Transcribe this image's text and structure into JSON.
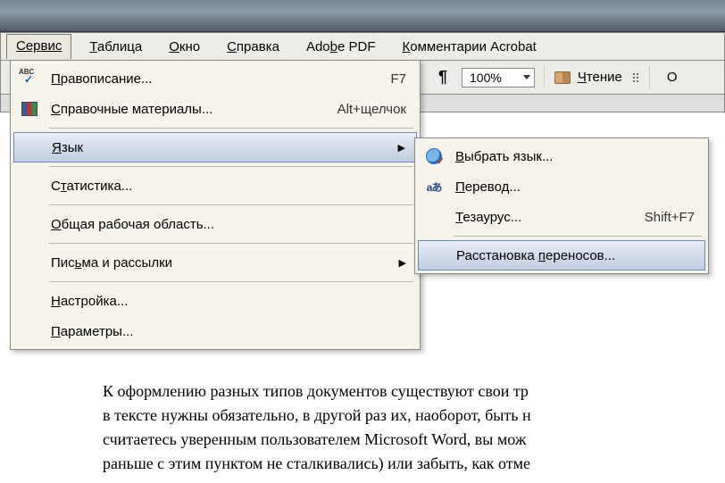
{
  "menubar": {
    "items": [
      {
        "label": "Сервис",
        "underline_index": 0
      },
      {
        "label": "Таблица",
        "underline_index": 0
      },
      {
        "label": "Окно",
        "underline_index": 0
      },
      {
        "label": "Справка",
        "underline_index": 0
      },
      {
        "label": "Adobe PDF",
        "underline_index": 2
      },
      {
        "label": "Комментарии Acrobat",
        "underline_index": 0
      }
    ]
  },
  "toolbar": {
    "pilcrow": "¶",
    "zoom": "100%",
    "read_label": "Чтение",
    "truncated": "О"
  },
  "main_menu": {
    "items": [
      {
        "label": "Правописание...",
        "shortcut": "F7",
        "icon": "abc",
        "underline_text": "П"
      },
      {
        "label": "Справочные материалы...",
        "shortcut": "Alt+щелчок",
        "icon": "books",
        "underline_text": "С"
      },
      {
        "label": "Язык",
        "has_submenu": true,
        "highlighted": true,
        "underline_text": "Я"
      },
      {
        "label": "Статистика...",
        "underline_text": "т"
      },
      {
        "label": "Общая рабочая область...",
        "underline_text": "О"
      },
      {
        "label": "Письма и рассылки",
        "has_submenu": true,
        "underline_text": "ь"
      },
      {
        "label": "Настройка...",
        "underline_text": "Н"
      },
      {
        "label": "Параметры...",
        "underline_text": "П"
      }
    ]
  },
  "sub_menu": {
    "items": [
      {
        "label": "Выбрать язык...",
        "icon": "globe",
        "underline_text": "В"
      },
      {
        "label": "Перевод...",
        "icon": "trans",
        "underline_text": "П"
      },
      {
        "label": "Тезаурус...",
        "shortcut": "Shift+F7",
        "underline_text": "Т"
      },
      {
        "label": "Расстановка переносов...",
        "highlighted": true,
        "underline_text": "п"
      }
    ]
  },
  "document": {
    "line1": "К оформлению разных типов документов существуют свои тр",
    "line2": "в тексте нужны обязательно, в другой раз их, наоборот, быть н",
    "line3": "считаетесь уверенным пользователем Microsoft Word, вы мож",
    "line4": "раньше с этим пунктом не сталкивались) или забыть, как отме"
  }
}
